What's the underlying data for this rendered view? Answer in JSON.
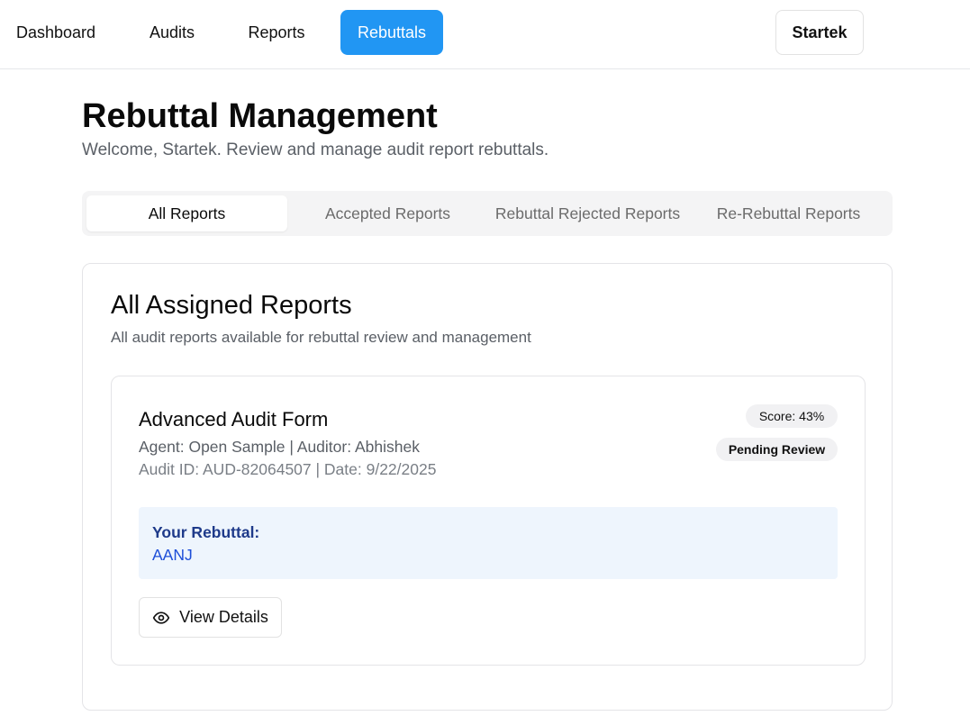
{
  "nav": {
    "items": [
      {
        "label": "Dashboard"
      },
      {
        "label": "Audits"
      },
      {
        "label": "Reports"
      },
      {
        "label": "Rebuttals",
        "active": true
      }
    ],
    "user_label": "Startek",
    "active_color": "#2196f3"
  },
  "page": {
    "title": "Rebuttal Management",
    "subtitle": "Welcome, Startek. Review and manage audit report rebuttals."
  },
  "tabs": [
    {
      "label": "All Reports",
      "active": true
    },
    {
      "label": "Accepted Reports"
    },
    {
      "label": "Rebuttal Rejected Reports"
    },
    {
      "label": "Re-Rebuttal Reports"
    }
  ],
  "section": {
    "title": "All Assigned Reports",
    "description": "All audit reports available for rebuttal review and management"
  },
  "report": {
    "title": "Advanced Audit Form",
    "meta_line1": "Agent: Open Sample | Auditor: Abhishek",
    "meta_line2": "Audit ID: AUD-82064507 | Date: 9/22/2025",
    "score_badge": "Score: 43%",
    "status_badge": "Pending Review",
    "rebuttal_label": "Your Rebuttal:",
    "rebuttal_text": "AANJ",
    "view_button_label": "View Details",
    "view_button_icon": "eye-icon"
  }
}
